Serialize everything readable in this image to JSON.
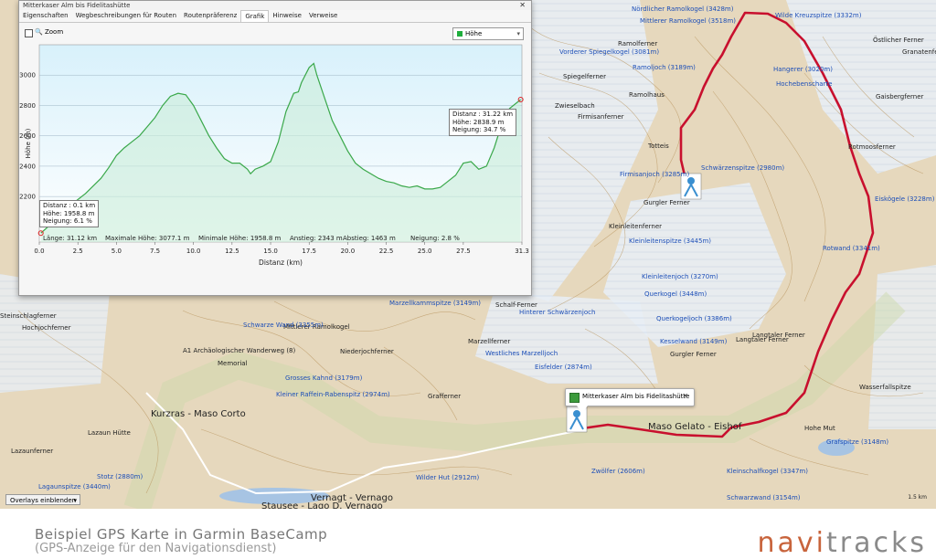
{
  "window": {
    "title": "Mitterkaser Alm bis Fidelitashütte",
    "close_symbol": "✕",
    "tabs": [
      "Eigenschaften",
      "Wegbeschreibungen für Routen",
      "Routenpräferenz",
      "Grafik",
      "Hinweise",
      "Verweise"
    ],
    "active_tab": "Grafik",
    "zoom_label": "Zoom",
    "metric_select": "Höhe",
    "metric_color": "#1fae3c"
  },
  "profile": {
    "tooltip_end": [
      "Distanz : 31.22 km",
      "Höhe: 2838.9 m",
      "Neigung: 34.7 %"
    ],
    "tooltip_start": [
      "Distanz : 0.1 km",
      "Höhe: 1958.8 m",
      "Neigung: 6.1 %"
    ],
    "stats": {
      "laenge": "Länge: 31.12 km",
      "max": "Maximale Höhe: 3077.1 m",
      "min": "Minimale Höhe: 1958.8 m",
      "anstieg": "Anstieg: 2343 m",
      "abstieg": "Abstieg: 1463 m",
      "neigung": "Neigung: 2.8 %"
    }
  },
  "chart_data": {
    "type": "area",
    "title": "",
    "xlabel": "Distanz  (km)",
    "ylabel": "Höhe (m)",
    "xlim": [
      0,
      31.3
    ],
    "ylim": [
      1900,
      3200
    ],
    "x_ticks": [
      "0.0",
      "2.5",
      "5.0",
      "7.5",
      "10.0",
      "12.5",
      "15.0",
      "17.5",
      "20.0",
      "22.5",
      "25.0",
      "27.5",
      "31.3"
    ],
    "x_tick_values": [
      0,
      2.5,
      5,
      7.5,
      10,
      12.5,
      15,
      17.5,
      20,
      22.5,
      25,
      27.5,
      31.3
    ],
    "y_ticks": [
      2200,
      2400,
      2600,
      2800,
      3000
    ],
    "series": [
      {
        "color": "#3aa84a",
        "x": [
          0.1,
          1.0,
          2.0,
          3.0,
          4.0,
          4.5,
          5.0,
          5.5,
          6.0,
          6.5,
          7.0,
          7.5,
          8.0,
          8.5,
          9.0,
          9.5,
          10.0,
          10.5,
          11.0,
          11.5,
          12.0,
          12.5,
          13.0,
          13.5,
          13.7,
          14.0,
          14.5,
          15.0,
          15.5,
          16.0,
          16.5,
          16.8,
          17.0,
          17.5,
          17.8,
          18.0,
          18.5,
          19.0,
          19.5,
          20.0,
          20.5,
          21.0,
          21.5,
          22.0,
          22.5,
          23.0,
          23.5,
          24.0,
          24.5,
          25.0,
          25.5,
          26.0,
          26.5,
          27.0,
          27.5,
          28.0,
          28.5,
          29.0,
          29.5,
          30.0,
          30.5,
          31.22
        ],
        "values": [
          1958.8,
          2040,
          2140,
          2220,
          2320,
          2390,
          2470,
          2520,
          2560,
          2600,
          2660,
          2720,
          2800,
          2860,
          2880,
          2870,
          2800,
          2700,
          2600,
          2520,
          2450,
          2420,
          2420,
          2380,
          2350,
          2380,
          2400,
          2430,
          2560,
          2760,
          2880,
          2890,
          2950,
          3050,
          3077.1,
          3000,
          2850,
          2700,
          2600,
          2500,
          2420,
          2380,
          2350,
          2320,
          2300,
          2290,
          2270,
          2260,
          2270,
          2250,
          2250,
          2260,
          2300,
          2340,
          2420,
          2430,
          2380,
          2400,
          2520,
          2680,
          2780,
          2838.9
        ]
      }
    ]
  },
  "map": {
    "popup_title": "Mitterkaser Alm bis Fidelitashütte",
    "popup_close": "✕",
    "overlays_label": "Overlays einblenden",
    "scale_label": "1.5 km",
    "labels": [
      {
        "t": "Nördlicher Ramolkogel (3428m)",
        "c": "blue"
      },
      {
        "t": "Mittlerer Ramolkogel (3518m)",
        "c": "blue"
      },
      {
        "t": "Wilde Kreuzspitze (3332m)",
        "c": "blue"
      },
      {
        "t": "Vorderer Spiegelkogel (3081m)",
        "c": "blue"
      },
      {
        "t": "Ramolferner",
        "c": ""
      },
      {
        "t": "Ramoljoch (3189m)",
        "c": "blue"
      },
      {
        "t": "Spiegelferner",
        "c": ""
      },
      {
        "t": "Ramolhaus",
        "c": ""
      },
      {
        "t": "Zwieselbach",
        "c": ""
      },
      {
        "t": "Firmisanferner",
        "c": ""
      },
      {
        "t": "Totteis",
        "c": ""
      },
      {
        "t": "Hangerer (3020m)",
        "c": "blue"
      },
      {
        "t": "Hochebenscharte",
        "c": "blue"
      },
      {
        "t": "Gaisbergferner",
        "c": ""
      },
      {
        "t": "Rotmoosferner",
        "c": ""
      },
      {
        "t": "Schwärzenspitze (2980m)",
        "c": "blue"
      },
      {
        "t": "Firmisanjoch (3285m)",
        "c": "blue"
      },
      {
        "t": "Gurgler Ferner",
        "c": ""
      },
      {
        "t": "Kleinleitenferner",
        "c": ""
      },
      {
        "t": "Kleinleitenspitze (3445m)",
        "c": "blue"
      },
      {
        "t": "Kleinleitenjoch (3270m)",
        "c": "blue"
      },
      {
        "t": "Querkogel (3448m)",
        "c": "blue"
      },
      {
        "t": "Querkogeljoch (3386m)",
        "c": "blue"
      },
      {
        "t": "Langtaler Ferner",
        "c": ""
      },
      {
        "t": "Rotwand (3341m)",
        "c": "blue"
      },
      {
        "t": "Hinterer Schwärzenjoch",
        "c": "blue"
      },
      {
        "t": "Schalf-Ferner",
        "c": ""
      },
      {
        "t": "Marzellferner",
        "c": ""
      },
      {
        "t": "Marzellkammspitze (3149m)",
        "c": "blue"
      },
      {
        "t": "Westliches Marzelljoch",
        "c": "blue"
      },
      {
        "t": "Mittlerer Ramolkogel",
        "c": ""
      },
      {
        "t": "Hochjochferner",
        "c": ""
      },
      {
        "t": "Niederjochferner",
        "c": ""
      },
      {
        "t": "Schwarze Wand (3355m)",
        "c": "blue"
      },
      {
        "t": "Grosses Kahnd (3179m)",
        "c": "blue"
      },
      {
        "t": "Kleiner Raffein-Rabenspitz (2974m)",
        "c": "blue"
      },
      {
        "t": "Kurzras - Maso Corto",
        "c": ""
      },
      {
        "t": "Maso Gelato - Eishof",
        "c": ""
      },
      {
        "t": "Vernagt - Vernago",
        "c": ""
      },
      {
        "t": "Grafferner",
        "c": ""
      },
      {
        "t": "Gurgler Ferner",
        "c": ""
      },
      {
        "t": "Kleinschalfkogel (3347m)",
        "c": "blue"
      },
      {
        "t": "Kesselwand (3149m)",
        "c": "blue"
      },
      {
        "t": "Eisfelder (2874m)",
        "c": "blue"
      },
      {
        "t": "Wilder Hut (2912m)",
        "c": "blue"
      },
      {
        "t": "Stotz (2880m)",
        "c": "blue"
      },
      {
        "t": "Lagaunspitze (3440m)",
        "c": "blue"
      },
      {
        "t": "Zwölfer (2606m)",
        "c": "blue"
      },
      {
        "t": "Schwarzwand (3154m)",
        "c": "blue"
      },
      {
        "t": "Grafspitze (3148m)",
        "c": "blue"
      },
      {
        "t": "Lazaunferner",
        "c": ""
      },
      {
        "t": "Steinschlagferner",
        "c": ""
      },
      {
        "t": "Lazaun Hütte",
        "c": ""
      },
      {
        "t": "Stausee - Lago D. Vernago",
        "c": ""
      },
      {
        "t": "A1 Archäologischer Wanderweg (8)",
        "c": ""
      },
      {
        "t": "Memorial",
        "c": ""
      },
      {
        "t": "Langtaler Ferner",
        "c": ""
      },
      {
        "t": "Östlicher Ferner",
        "c": ""
      },
      {
        "t": "Granatenferner",
        "c": ""
      },
      {
        "t": "Eiskögele (3228m)",
        "c": "blue"
      },
      {
        "t": "Hohe Mut",
        "c": ""
      },
      {
        "t": "Wasserfallspitze",
        "c": ""
      }
    ]
  },
  "footer": {
    "caption": "Beispiel GPS Karte in Garmin BaseCamp",
    "caption2": "(GPS-Anzeige für den Navigationsdienst)",
    "logo_a": "navi",
    "logo_b": "tracks",
    "logo_a_color": "#c8643c",
    "logo_b_color": "#8a8a8a"
  }
}
